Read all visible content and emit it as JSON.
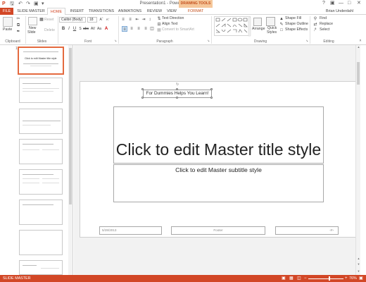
{
  "window": {
    "title": "Presentation1 - PowerPoint",
    "contextual_tab": "DRAWING TOOLS",
    "quick_access": [
      "powerpoint-logo-icon",
      "save-icon",
      "undo-icon",
      "redo-icon",
      "start-from-beginning-icon",
      "customize-qat-icon"
    ],
    "controls": [
      "help-icon",
      "ribbon-display-options-icon",
      "minimize-icon",
      "restore-icon",
      "close-icon"
    ]
  },
  "tabs": [
    {
      "label": "FILE",
      "state": "file"
    },
    {
      "label": "SLIDE MASTER",
      "state": ""
    },
    {
      "label": "HOME",
      "state": "active"
    },
    {
      "label": "INSERT",
      "state": ""
    },
    {
      "label": "TRANSITIONS",
      "state": ""
    },
    {
      "label": "ANIMATIONS",
      "state": ""
    },
    {
      "label": "REVIEW",
      "state": ""
    },
    {
      "label": "VIEW",
      "state": ""
    },
    {
      "label": "FORMAT",
      "state": "format"
    }
  ],
  "user": {
    "name": "Brian Underdahl"
  },
  "ribbon": {
    "clipboard": {
      "label": "Clipboard",
      "paste": "Paste"
    },
    "slides": {
      "label": "Slides",
      "new_slide": "New",
      "new_slide_2": "Slide",
      "reset": "Reset",
      "delete": "Delete"
    },
    "font": {
      "label": "Font",
      "font_name": "Calibri (Body)",
      "font_size": "18"
    },
    "paragraph": {
      "label": "Paragraph",
      "text_direction": "Text Direction",
      "align_text": "Align Text",
      "convert_smartart": "Convert to SmartArt"
    },
    "drawing": {
      "label": "Drawing",
      "arrange": "Arrange",
      "quick_styles_1": "Quick",
      "quick_styles_2": "Styles",
      "shape_fill": "Shape Fill",
      "shape_outline": "Shape Outline",
      "shape_effects": "Shape Effects"
    },
    "editing": {
      "label": "Editing",
      "find": "Find",
      "replace": "Replace",
      "select": "Select"
    }
  },
  "thumbnails": {
    "count": 8,
    "selected_index": 0,
    "first_title": "Click to edit Master title style"
  },
  "slide": {
    "header_text": "For Dummies Helps You Learn!",
    "title": "Click to edit Master title style",
    "subtitle": "Click to edit Master subtitle style",
    "date": "5/28/2013",
    "footer": "Footer",
    "page_number": "‹#›"
  },
  "status": {
    "mode": "SLIDE MASTER",
    "zoom": "76%",
    "zoom_fraction": 0.6,
    "view_icons": [
      "normal-view-icon",
      "slide-sorter-view-icon",
      "reading-view-icon"
    ]
  }
}
